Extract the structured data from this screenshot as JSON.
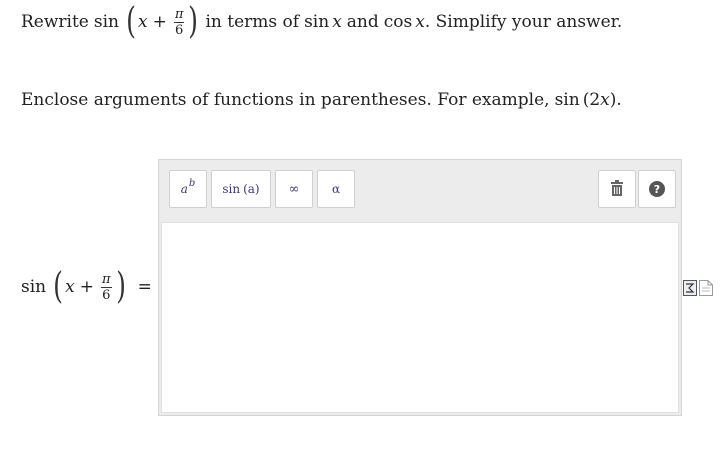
{
  "question": {
    "prefix": "Rewrite",
    "fn": "sin",
    "var": "x",
    "plus": "+",
    "num": "π",
    "den": "6",
    "middle": "in terms of",
    "sin_fn": "sin",
    "sin_var": "x",
    "and": "and",
    "cos_fn": "cos",
    "cos_var": "x",
    "suffix": ". Simplify your answer."
  },
  "instruction": {
    "text": "Enclose arguments of functions in parentheses. For example,",
    "ex_fn": "sin",
    "ex_open": "(",
    "ex_num": "2",
    "ex_var": "x",
    "ex_close": ").",
    "end": ""
  },
  "answer_label": {
    "fn": "sin",
    "var": "x",
    "plus": "+",
    "num": "π",
    "den": "6",
    "equals": "="
  },
  "toolbar": {
    "power_base": "a",
    "power_exp": "b",
    "sin_label": "sin",
    "sin_arg": "(a)",
    "infinity": "∞",
    "alpha": "α",
    "help": "?"
  },
  "icons": {
    "trash": "trash-icon",
    "help": "help-icon",
    "equation": "equation-icon",
    "document": "document-icon"
  }
}
